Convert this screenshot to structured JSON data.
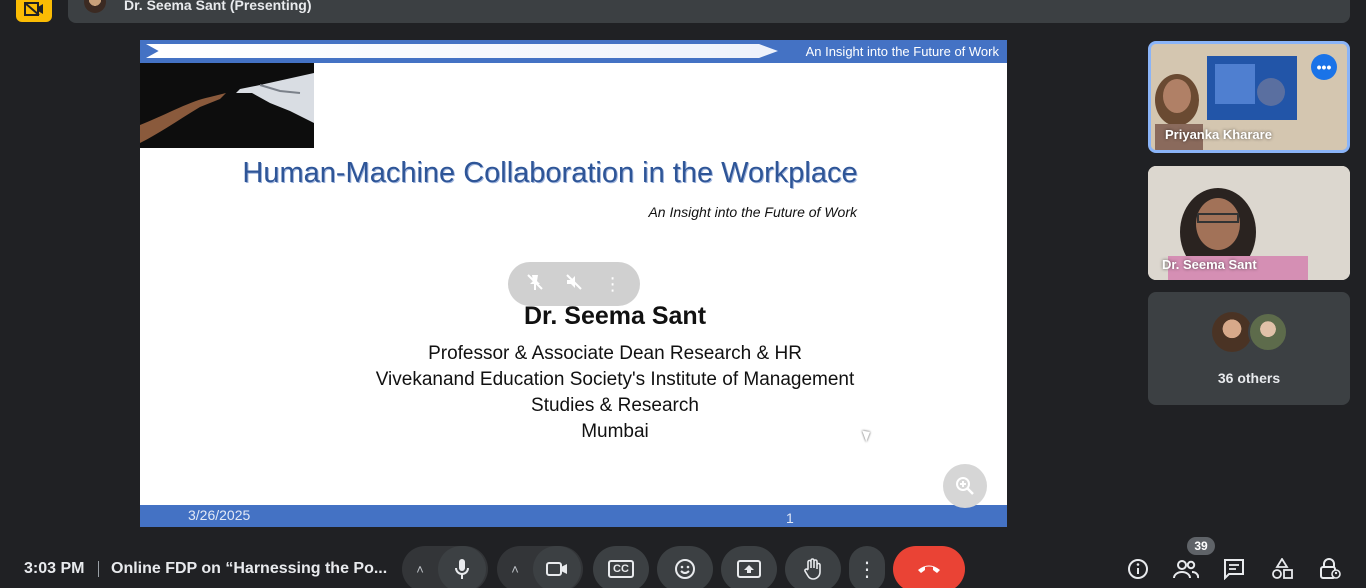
{
  "header": {
    "presenter_title": "Dr. Seema Sant (Presenting)"
  },
  "slide": {
    "header_text": "An Insight into the Future of Work",
    "title": "Human-Machine Collaboration in the Workplace",
    "subtitle": "An Insight into the Future of Work",
    "presenter_name": "Dr. Seema Sant",
    "lines": [
      "Professor & Associate Dean Research & HR",
      "Vivekanand Education Society's Institute of Management",
      "Studies & Research",
      "Mumbai"
    ],
    "footer_date": "3/26/2025",
    "footer_page": "1"
  },
  "participants": {
    "tile_1_name": "Priyanka Kharare",
    "tile_2_name": "Dr. Seema Sant",
    "others_label": "36 others"
  },
  "bottom_bar": {
    "time": "3:03 PM",
    "meeting_title": "Online FDP on “Harnessing the Po...",
    "people_count": "39"
  },
  "icons": {
    "caption_icon_text": "CC",
    "more_dots": "⋮",
    "caret_up": "˄"
  },
  "colors": {
    "accent": "#4472c4",
    "end_call": "#ea4335",
    "active_speaker": "#8ab4f8",
    "brand_yellow": "#fbbc04"
  }
}
